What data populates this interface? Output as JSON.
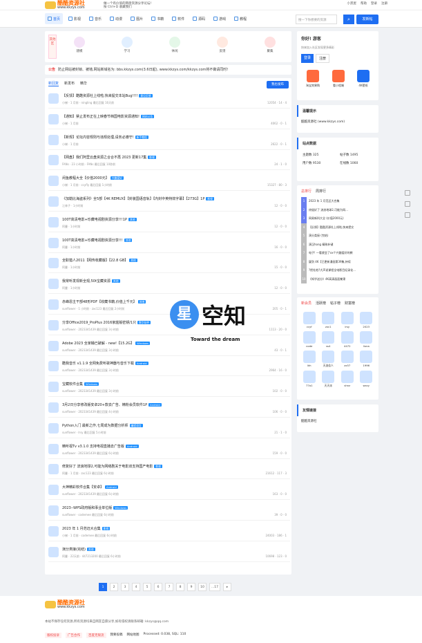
{
  "header": {
    "site_name": "酷酷资源社",
    "domain": "www.kkzys.com",
    "slogan": "做一个有价值的网盘资源分享论坛!",
    "shortcut": "按 Ctrl+D 收藏我们",
    "links": [
      "小黑屋",
      "帮助",
      "登录",
      "注册"
    ]
  },
  "nav": {
    "items": [
      "首页",
      "影视",
      "音乐",
      "动漫",
      "图片",
      "书籍",
      "软件",
      "源码",
      "游戏",
      "教程"
    ]
  },
  "search": {
    "placeholder": "搜一下你想要的资源",
    "post_label": "发新帖"
  },
  "categories": {
    "label": "其他区",
    "items": [
      "建模",
      "学习",
      "休闲",
      "反馈",
      "聚集"
    ]
  },
  "notice": {
    "label": "公告",
    "text": "防止网站被封锁、被墙,网站新域名为: bbs.kkzys.com(3.6日起), www.kkzys.com/kkzys.com将不做请同时!"
  },
  "list": {
    "tabs": [
      "新回复",
      "新发布",
      "精华"
    ],
    "new_post": "我也发布",
    "rows": [
      {
        "title": "【反馈】酷酷资源社上线啦,快来提交本站Bug!!!!",
        "tag": "意见反馈",
        "meta": "小梯 · 1 月前 · ningling 最后回复 16天前",
        "stats": "12054 · 14 · 4"
      },
      {
        "title": "【通知】禁止发布正在上映春节档国电影资源通知!",
        "tag": "网站公告",
        "meta": "小梯 · 1 月前",
        "stats": "4062 · 0 · 1"
      },
      {
        "title": "【新规】论坛内容规则与违规处理,请务必遵守!",
        "tag": "新手教程",
        "meta": "小梯 · 1 月前",
        "stats": "2622 · 0 · 1"
      },
      {
        "title": "【网盘】我们阿里云盘资源之合合不再 2023 更新17集",
        "tag": "影视",
        "meta": "FANs · 23 小时前 · FANs 最后回复 10秒前",
        "stats": "24 · 1 · 0"
      },
      {
        "title": "闲鱼教程大全【价值2000元】",
        "tag": "兴趣爱好",
        "meta": "小梯 · 1 月前 · ccyfly 最后回复 1小时前",
        "stats": "15327 · 80 · 3"
      },
      {
        "title": "《加勒比海盗系列》全5部【4K REMUX】【封装国语音轨】【内封中英特效字幕】【273G】1P",
        "tag": "影视",
        "meta": "江林子 · 1小时前",
        "stats": "12 · 0 · 0"
      },
      {
        "title": "100T高清电影+珍藏电视剧资源分享!!!1P",
        "tag": "其他",
        "meta": "阿曼 · 1小时前",
        "stats": "12 · 0 · 0"
      },
      {
        "title": "100T高清电影+珍藏电视剧资源分享!!!",
        "tag": "其他",
        "meta": "阿曼 · 1小时前",
        "stats": "16 · 0 · 0"
      },
      {
        "title": "全职猎人2011【网传收藏版】【22.8 GB】",
        "tag": "其他",
        "meta": "阿曼 · 1小时前",
        "stats": "15 · 0 · 0"
      },
      {
        "title": "我常听发现新全观,50t宝藏资源",
        "tag": "其他",
        "meta": "阿曼 · 1小时前",
        "stats": "12 · 0 · 0"
      },
      {
        "title": "赤峰恩主干部48形PDF【收藏书籍,价值上千元】",
        "tag": "其他",
        "meta": "sunflower · 1 小时前 · zxc123 最后回复 2小时前",
        "stats": "205 · 0 · 1"
      },
      {
        "title": "分享Office2019_ProPlus 2016家庭版密钥/1只",
        "tag": "数字软件",
        "meta": "sunflower · 2023341439 最后回复 3小时前",
        "stats": "1113 · 20 · 0"
      },
      {
        "title": "Adobe 2023 全家桶已破解 - new!【15.2G】",
        "tag": "Windows",
        "meta": "sunflower · 2023341439 最后回复 3小时前",
        "stats": "43 · 0 · 1"
      },
      {
        "title": "酷我音乐 v1.1.9 全网免费听歌神器与音乐下载",
        "tag": "Android",
        "meta": "sunflower · 2023341439 最后回复 3小时前",
        "stats": "2964 · 16 · 0"
      },
      {
        "title": "宝藏软件合集",
        "tag": "Windows",
        "meta": "sunflower · 2023341439 最后回复 3小时前",
        "stats": "102 · 0 · 0"
      },
      {
        "title": "3月2日分享修改版安卓20+款去广告、精粉会员软件1P",
        "tag": "Android",
        "meta": "sunflower · 2023341439 最后回复 4小时前",
        "stats": "106 · 0 · 0"
      },
      {
        "title": "Python入门 最新之作,七周成为数据分析师",
        "tag": "编程语言",
        "meta": "sunflower · lrsy 最后回复 5小时前",
        "stats": "21 · 1 · 0"
      },
      {
        "title": "精听视Tv v3.1.0 支持电视直播去广告版",
        "tag": "Android",
        "meta": "sunflower · 2023341439 最后回复 6小时前",
        "stats": "159 · 0 · 0"
      },
      {
        "title": "修复好了 流浪地球2,可能为网络剧关于电影双支持国产电影",
        "tag": "影视",
        "meta": "阿曼 · 1 月前 · zxc123 最后回复 6小时前",
        "stats": "21612 · 117 · 3"
      },
      {
        "title": "大神精彩软件合集【安卓】",
        "tag": "Android",
        "meta": "sunflower · 2023341439 最后回复 6小时前",
        "stats": "163 · 0 · 0"
      },
      {
        "title": "2023--WPS政府版和事业单位版",
        "tag": "Windows",
        "meta": "sunflower · codemee 最后回复 6小时前",
        "stats": "39 · 0 · 0"
      },
      {
        "title": "2023 年 1 月范迈大合集",
        "tag": "影视",
        "meta": "小梯 · 1 月前 · codemee 最后回复 6小时前",
        "stats": "24003 · 186 · 1"
      },
      {
        "title": "演分类接(完结)",
        "tag": "其他",
        "meta": "阿曼 · 22天前 · 447213200 最后回复 6小时前",
        "stats": "10698 · 123 · 0"
      }
    ]
  },
  "pager": {
    "pages": [
      "1",
      "2",
      "3",
      "4",
      "5",
      "6",
      "7",
      "8",
      "9",
      "10",
      "...17",
      "▸"
    ]
  },
  "sidebar": {
    "welcome": "你好! 游客",
    "welcome_sub": "快来加入社区发现更多精彩",
    "login": "登录",
    "register": "注册",
    "apps": [
      "淘宝宾果购",
      "看小程端",
      "4K壁纸"
    ],
    "tip_title": "温馨提示",
    "tip_text": "酷酷资源社 (www.kkzys.com)",
    "stats_title": "站点数据",
    "stats": [
      "主题数 325",
      "帖子数 1495",
      "用户数 9530",
      "在线数 1060"
    ],
    "rank_tabs": [
      "总排行",
      "周排行"
    ],
    "rank_items": [
      "2023 年 1 月范迈大合集",
      "终极好了 流浪地球2,可能为网...",
      "网易新科大全 (价值2000元)",
      "【反馈】酷酷资源社上线啦,快来提交",
      "演分类接 (完结)",
      "演汉hong 精致补键",
      "电子! 一看就会了xx个兴趣爱好的教",
      "疑剑 4K【已更新漫画第39集,持续",
      "?把杜柏?大声说课程全电影目纪录化...",
      "《知乎送分》4K高清画面集锦"
    ],
    "new_member_tabs": [
      "新会员",
      "活跃榜",
      "帖子榜",
      "财富榜"
    ],
    "members": [
      "ccyf",
      "zxc1",
      "lrsy",
      "2023",
      "code",
      "ss4",
      "4472",
      "liuna",
      "lkh",
      "天选佳人",
      "zx57",
      "1996",
      "77a1",
      "天天派",
      "shnz",
      "wxcy"
    ],
    "links_title": "友情链接",
    "links_text": "酷酷资源社"
  },
  "watermark": {
    "char": "星",
    "text": "空知",
    "sub": "Toward the dream"
  },
  "footer": {
    "site_name": "酷酷资源社",
    "domain": "www.kkzys.com",
    "disclaimer": "本站不保存任何资源,所有资源均来自网友自愿分享,如有侵权请联系邮箱: kkzys@qq.com",
    "links": [
      "版权投诉",
      "广告合作",
      "百度无限流",
      "我要投稿",
      "网站地图"
    ],
    "processed": "Processed: 0.038, SQL: 110"
  }
}
